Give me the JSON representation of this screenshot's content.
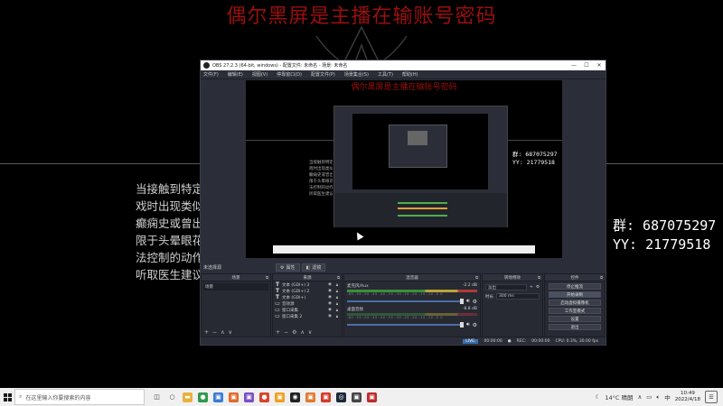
{
  "background": {
    "headline": "偶尔黑屏是主播在输账号密码",
    "left_text_lines": [
      "当接触到特定",
      "戏时出现类似",
      "癫痫史或曾出",
      "限于头晕眼花",
      "法控制的动作",
      "听取医生建议"
    ],
    "qq_group": "群: 687075297",
    "yy_id": "YY: 21779518"
  },
  "obs": {
    "window_title": "OBS 27.2.3 (64-bit, windows) - 配置文件: 未命名 - 场景: 未命名",
    "window_buttons": {
      "minimize": "—",
      "maximize": "☐",
      "close": "✕"
    },
    "menu": [
      "文件(F)",
      "编辑(E)",
      "视图(V)",
      "停靠窗口(D)",
      "配置文件(P)",
      "场景集合(S)",
      "工具(T)",
      "帮助(H)"
    ],
    "preview": {
      "headline": "偶尔黑屏是主播在输账号密码",
      "qq_group": "群: 687075297",
      "yy_id": "YY: 21779518"
    },
    "tabstrip": {
      "source_label": "未选择源",
      "properties": "属性",
      "filters": "滤镜"
    },
    "docks": {
      "scenes": {
        "title": "场景",
        "items": [
          "场景"
        ]
      },
      "sources": {
        "title": "来源",
        "items": [
          {
            "name": "文本 (GDI+) 3",
            "glyph": "T"
          },
          {
            "name": "文本 (GDI+) 2",
            "glyph": "T"
          },
          {
            "name": "文本 (GDI+)",
            "glyph": "T"
          },
          {
            "name": "音效源",
            "glyph": "▭"
          },
          {
            "name": "窗口采集",
            "glyph": "▭"
          },
          {
            "name": "窗口采集 2",
            "glyph": "▭"
          }
        ]
      },
      "mixer": {
        "title": "混音器",
        "ticks": "-60 -55 -50 -45 -40 -35 -30 -25 -20 -15 -10 -5 0",
        "channels": [
          {
            "name": "麦克风/Aux",
            "level": "-2.2 dB"
          },
          {
            "name": "桌面音频",
            "level": "-8.8 dB"
          }
        ]
      },
      "transitions": {
        "title": "转场特效",
        "type": "淡出",
        "duration_label": "时长",
        "duration_value": "300 ms"
      },
      "controls": {
        "title": "控件",
        "buttons": [
          "停止推流",
          "开始录制",
          "启动虚拟摄像机",
          "工作室模式",
          "设置",
          "退出"
        ]
      }
    },
    "status": {
      "live_label": "LIVE:",
      "live_time": "00:00:00",
      "rec_label": "REC:",
      "rec_time": "00:00:00",
      "cpu": "CPU: 0.3%, 30.00 fps"
    }
  },
  "taskbar": {
    "search_placeholder": "在这里输入你要搜索的内容",
    "weather": "14°C 晴朗",
    "time": "10:49",
    "date": "2022/4/18",
    "icons": [
      {
        "name": "task-view-icon",
        "color": "#333333",
        "glyph": "◫"
      },
      {
        "name": "cortana-icon",
        "color": "#333333",
        "glyph": "○"
      },
      {
        "name": "file-explorer-icon",
        "color": "#e8b13a",
        "glyph": "▬"
      },
      {
        "name": "chrome-icon",
        "color": "#2f9a4a",
        "glyph": "●"
      },
      {
        "name": "app-icon-1",
        "color": "#3a7bd5",
        "glyph": "▣"
      },
      {
        "name": "app-icon-2",
        "color": "#e06a2a",
        "glyph": "▣"
      },
      {
        "name": "app-icon-3",
        "color": "#7a4fc9",
        "glyph": "▣"
      },
      {
        "name": "app-icon-4",
        "color": "#d9442a",
        "glyph": "●"
      },
      {
        "name": "app-icon-5",
        "color": "#f0a020",
        "glyph": "▣"
      },
      {
        "name": "obs-icon",
        "color": "#222222",
        "glyph": "◉"
      },
      {
        "name": "app-icon-6",
        "color": "#e07a30",
        "glyph": "▣"
      },
      {
        "name": "app-icon-7",
        "color": "#d33a2a",
        "glyph": "▣"
      },
      {
        "name": "steam-icon",
        "color": "#1b2838",
        "glyph": "◎"
      },
      {
        "name": "app-icon-8",
        "color": "#444444",
        "glyph": "▣"
      },
      {
        "name": "app-icon-9",
        "color": "#c0282a",
        "glyph": "▣"
      }
    ]
  }
}
